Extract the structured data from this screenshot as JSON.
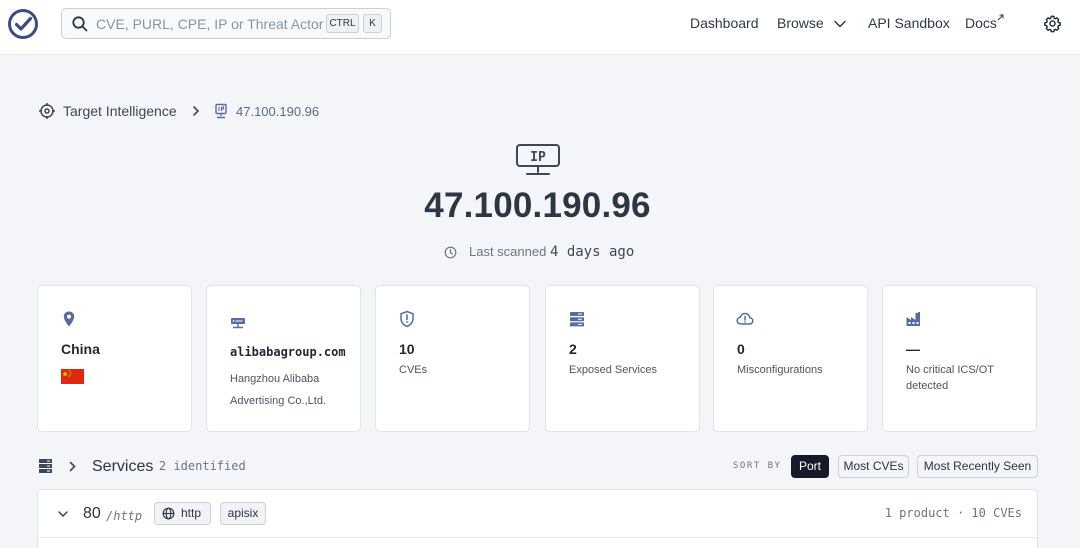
{
  "search": {
    "placeholder": "CVE, PURL, CPE, IP or Threat Actor",
    "shortcut_ctrl": "CTRL",
    "shortcut_key": "K"
  },
  "nav": {
    "dashboard": "Dashboard",
    "browse": "Browse",
    "api_sandbox": "API Sandbox",
    "docs": "Docs"
  },
  "breadcrumb": {
    "section": "Target Intelligence",
    "current": "47.100.190.96"
  },
  "hero": {
    "icon_label": "IP",
    "ip": "47.100.190.96",
    "last_scanned_label": "Last scanned",
    "last_scanned_value": "4 days ago"
  },
  "cards": {
    "location": {
      "country": "China",
      "icon": "map-pin-icon",
      "flag_color": "#de2910"
    },
    "org": {
      "domain": "alibabagroup.com",
      "name": "Hangzhou Alibaba Advertising Co.,Ltd.",
      "icon": "server-rack-icon"
    },
    "cves": {
      "value": "10",
      "label": "CVEs",
      "icon": "shield-icon"
    },
    "services": {
      "value": "2",
      "label": "Exposed Services",
      "icon": "database-icon"
    },
    "misconfig": {
      "value": "0",
      "label": "Misconfigurations",
      "icon": "cloud-alert-icon"
    },
    "ics": {
      "value": "—",
      "label": "No critical ICS/OT detected",
      "icon": "factory-icon"
    }
  },
  "services": {
    "title": "Services",
    "count": "2 identified",
    "sort_by": "SORT BY",
    "sort_options": [
      "Port",
      "Most CVEs",
      "Most Recently Seen"
    ],
    "active_sort": "Port",
    "rows": [
      {
        "port": "80",
        "proto": "/http",
        "tags": [
          "http",
          "apisix"
        ],
        "meta": "1 product · 10 CVEs"
      }
    ]
  },
  "colors": {
    "accent_icon": "#5a6aa8",
    "active_sort_bg": "#151b2b",
    "background": "#f3f5f8"
  }
}
